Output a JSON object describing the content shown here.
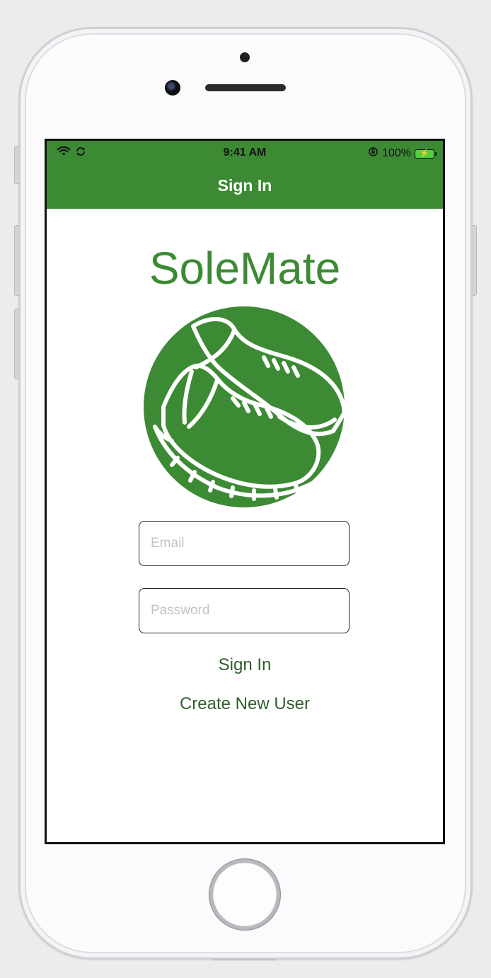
{
  "status_bar": {
    "time": "9:41 AM",
    "battery_percent": "100%",
    "icons": [
      "wifi-icon",
      "sync-icon",
      "orientation-lock-icon",
      "battery-charging-icon"
    ]
  },
  "nav": {
    "title": "Sign In"
  },
  "app": {
    "name": "SoleMate",
    "logo_icon": "running-shoes-icon"
  },
  "form": {
    "email_placeholder": "Email",
    "email_value": "",
    "password_placeholder": "Password",
    "password_value": "",
    "sign_in_label": "Sign In",
    "create_user_label": "Create New User"
  },
  "colors": {
    "brand_green": "#3d8a35",
    "link_green": "#2f5f2a",
    "battery_green": "#4fd03c"
  }
}
